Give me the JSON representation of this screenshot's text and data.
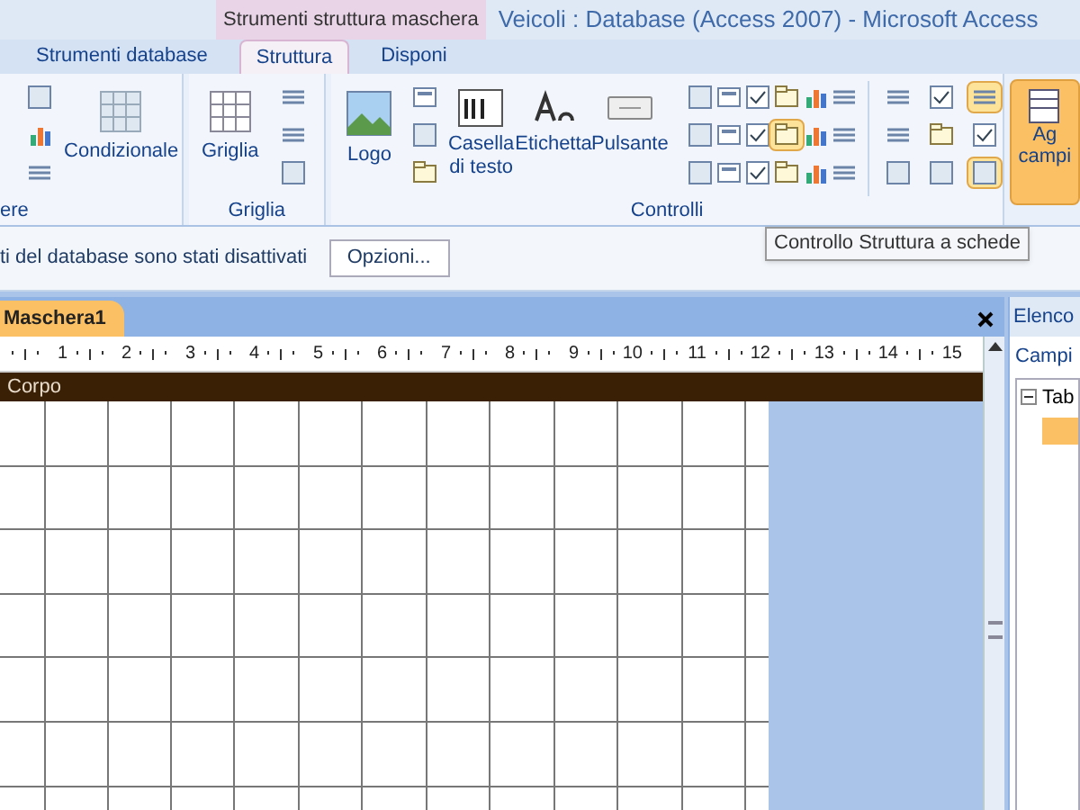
{
  "title_bar": {
    "context_tab": "Strumenti struttura maschera",
    "title": "Veicoli : Database (Access 2007) - Microsoft Access"
  },
  "tabs": [
    {
      "label": "Strumenti database",
      "selected": false
    },
    {
      "label": "Struttura",
      "selected": true
    },
    {
      "label": "Disponi",
      "selected": false
    }
  ],
  "ribbon": {
    "format_group": {
      "label": "ere",
      "button": "Condizionale"
    },
    "grid_group": {
      "label": "Griglia",
      "button": "Griglia"
    },
    "controls_group": {
      "label": "Controlli",
      "buttons": [
        "Logo",
        "Casella di testo",
        "Etichetta",
        "Pulsante"
      ],
      "tools": [
        {
          "selected": false
        },
        {
          "selected": false
        },
        {
          "selected": false
        },
        {
          "selected": false
        },
        {
          "selected": false
        },
        {
          "selected": false
        },
        {
          "selected": false
        },
        {
          "selected": false
        },
        {
          "selected": false
        },
        {
          "selected": true
        },
        {
          "selected": false
        },
        {
          "selected": false
        },
        {
          "selected": false
        },
        {
          "selected": false
        },
        {
          "selected": false
        },
        {
          "selected": false
        },
        {
          "selected": false
        },
        {
          "selected": false
        }
      ],
      "right_tools": [
        {
          "selected": true
        },
        {
          "selected": false
        },
        {
          "selected": true
        }
      ]
    },
    "fields_button": {
      "lines": [
        "Ag",
        "campi"
      ]
    }
  },
  "message_bar": {
    "text": "ti del database sono stati disattivati",
    "button": "Opzioni..."
  },
  "tooltip": "Controllo Struttura a schede",
  "document": {
    "tab": "Maschera1",
    "ruler": [
      "1",
      "2",
      "3",
      "4",
      "5",
      "6",
      "7",
      "8",
      "9",
      "10",
      "11",
      "12",
      "13",
      "14",
      "15"
    ],
    "section": "Corpo"
  },
  "field_list": {
    "title": "Elenco",
    "subtitle": "Campi",
    "tree": [
      {
        "label": "Tab",
        "expanded": true
      }
    ]
  }
}
